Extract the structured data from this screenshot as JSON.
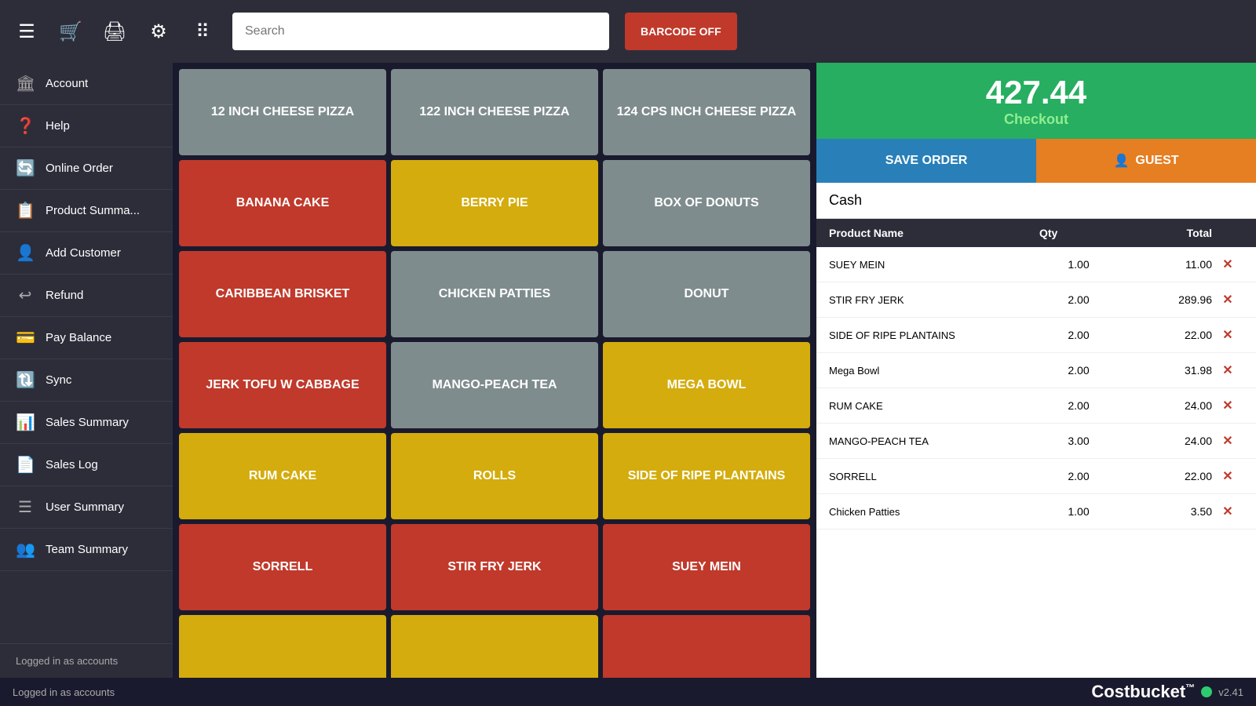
{
  "topbar": {
    "search_placeholder": "Search",
    "barcode_btn": "BARCODE OFF"
  },
  "sidebar": {
    "items": [
      {
        "id": "account",
        "label": "Account",
        "icon": "🏛"
      },
      {
        "id": "help",
        "label": "Help",
        "icon": "❓"
      },
      {
        "id": "online-order",
        "label": "Online Order",
        "icon": "🔄"
      },
      {
        "id": "product-summary",
        "label": "Product Summa...",
        "icon": "📋"
      },
      {
        "id": "add-customer",
        "label": "Add Customer",
        "icon": "👤"
      },
      {
        "id": "refund",
        "label": "Refund",
        "icon": "↩"
      },
      {
        "id": "pay-balance",
        "label": "Pay Balance",
        "icon": "💳"
      },
      {
        "id": "sync",
        "label": "Sync",
        "icon": "🔃"
      },
      {
        "id": "sales-summary",
        "label": "Sales Summary",
        "icon": "📊"
      },
      {
        "id": "sales-log",
        "label": "Sales Log",
        "icon": "📄"
      },
      {
        "id": "user-summary",
        "label": "User Summary",
        "icon": "☰"
      },
      {
        "id": "team-summary",
        "label": "Team Summary",
        "icon": "👥"
      }
    ],
    "logged_in": "Logged in as accounts"
  },
  "products": [
    {
      "name": "12 INCH CHEESE PIZZA",
      "color": "gray"
    },
    {
      "name": "122 INCH CHEESE PIZZA",
      "color": "gray"
    },
    {
      "name": "124 CPS INCH CHEESE PIZZA",
      "color": "gray"
    },
    {
      "name": "BANANA CAKE",
      "color": "red"
    },
    {
      "name": "BERRY PIE",
      "color": "yellow"
    },
    {
      "name": "BOX OF DONUTS",
      "color": "gray"
    },
    {
      "name": "CARIBBEAN BRISKET",
      "color": "red"
    },
    {
      "name": "CHICKEN PATTIES",
      "color": "gray"
    },
    {
      "name": "DONUT",
      "color": "gray"
    },
    {
      "name": "JERK TOFU W CABBAGE",
      "color": "red"
    },
    {
      "name": "MANGO-PEACH TEA",
      "color": "gray"
    },
    {
      "name": "MEGA BOWL",
      "color": "yellow"
    },
    {
      "name": "RUM CAKE",
      "color": "yellow"
    },
    {
      "name": "ROLLS",
      "color": "yellow"
    },
    {
      "name": "SIDE OF RIPE PLANTAINS",
      "color": "yellow"
    },
    {
      "name": "SORRELL",
      "color": "red"
    },
    {
      "name": "STIR FRY JERK",
      "color": "red"
    },
    {
      "name": "SUEY MEIN",
      "color": "red"
    },
    {
      "name": "",
      "color": "yellow"
    },
    {
      "name": "",
      "color": "yellow"
    },
    {
      "name": "",
      "color": "red"
    }
  ],
  "right_panel": {
    "total": "427.44",
    "checkout_label": "Checkout",
    "save_order_label": "SAVE ORDER",
    "guest_label": "GUEST",
    "payment_type": "Cash",
    "table_headers": {
      "product": "Product Name",
      "qty": "Qty",
      "total": "Total"
    },
    "order_items": [
      {
        "name": "SUEY MEIN",
        "qty": "1.00",
        "total": "11.00"
      },
      {
        "name": "STIR FRY JERK",
        "qty": "2.00",
        "total": "289.96"
      },
      {
        "name": "SIDE OF RIPE PLANTAINS",
        "qty": "2.00",
        "total": "22.00"
      },
      {
        "name": "Mega Bowl",
        "qty": "2.00",
        "total": "31.98"
      },
      {
        "name": "RUM CAKE",
        "qty": "2.00",
        "total": "24.00"
      },
      {
        "name": "MANGO-PEACH TEA",
        "qty": "3.00",
        "total": "24.00"
      },
      {
        "name": "SORRELL",
        "qty": "2.00",
        "total": "22.00"
      },
      {
        "name": "Chicken Patties",
        "qty": "1.00",
        "total": "3.50"
      }
    ]
  },
  "brand": {
    "name": "Costbucket",
    "tm": "™",
    "version": "v2.41"
  }
}
